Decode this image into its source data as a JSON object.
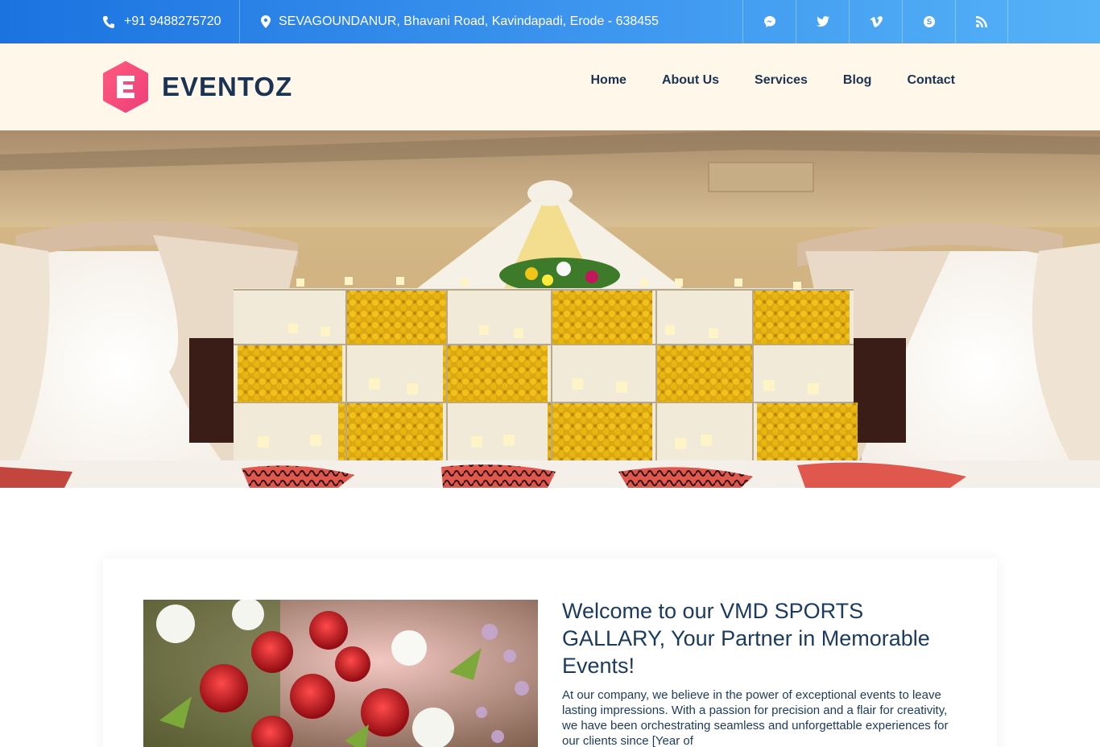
{
  "topbar": {
    "phone": "+91 9488275720",
    "address": "SEVAGOUNDANUR, Bhavani Road, Kavindapadi, Erode - 638455",
    "social": [
      {
        "icon": "messenger-icon"
      },
      {
        "icon": "twitter-icon"
      },
      {
        "icon": "vimeo-icon"
      },
      {
        "icon": "skype-icon"
      },
      {
        "icon": "rss-icon"
      }
    ]
  },
  "header": {
    "logo_letter": "E",
    "logo_text": "EVENTOZ",
    "nav": [
      "Home",
      "About Us",
      "Services",
      "Blog",
      "Contact"
    ]
  },
  "about": {
    "heading": "Welcome to our VMD SPORTS GALLARY, Your Partner in Memorable Events!",
    "body": "At our company, we believe in the power of exceptional events to leave lasting impressions. With a passion for precision and a flair for creativity, we have been orchestrating seamless and unforgettable experiences for our clients since [Year of"
  },
  "colors": {
    "topbar_start": "#1a73e0",
    "topbar_end": "#55b2f7",
    "header_bg": "#fff7ea",
    "brand_dark": "#1b3352",
    "logo_gradient_start": "#ff4f7a",
    "logo_gradient_end": "#f0477a"
  }
}
